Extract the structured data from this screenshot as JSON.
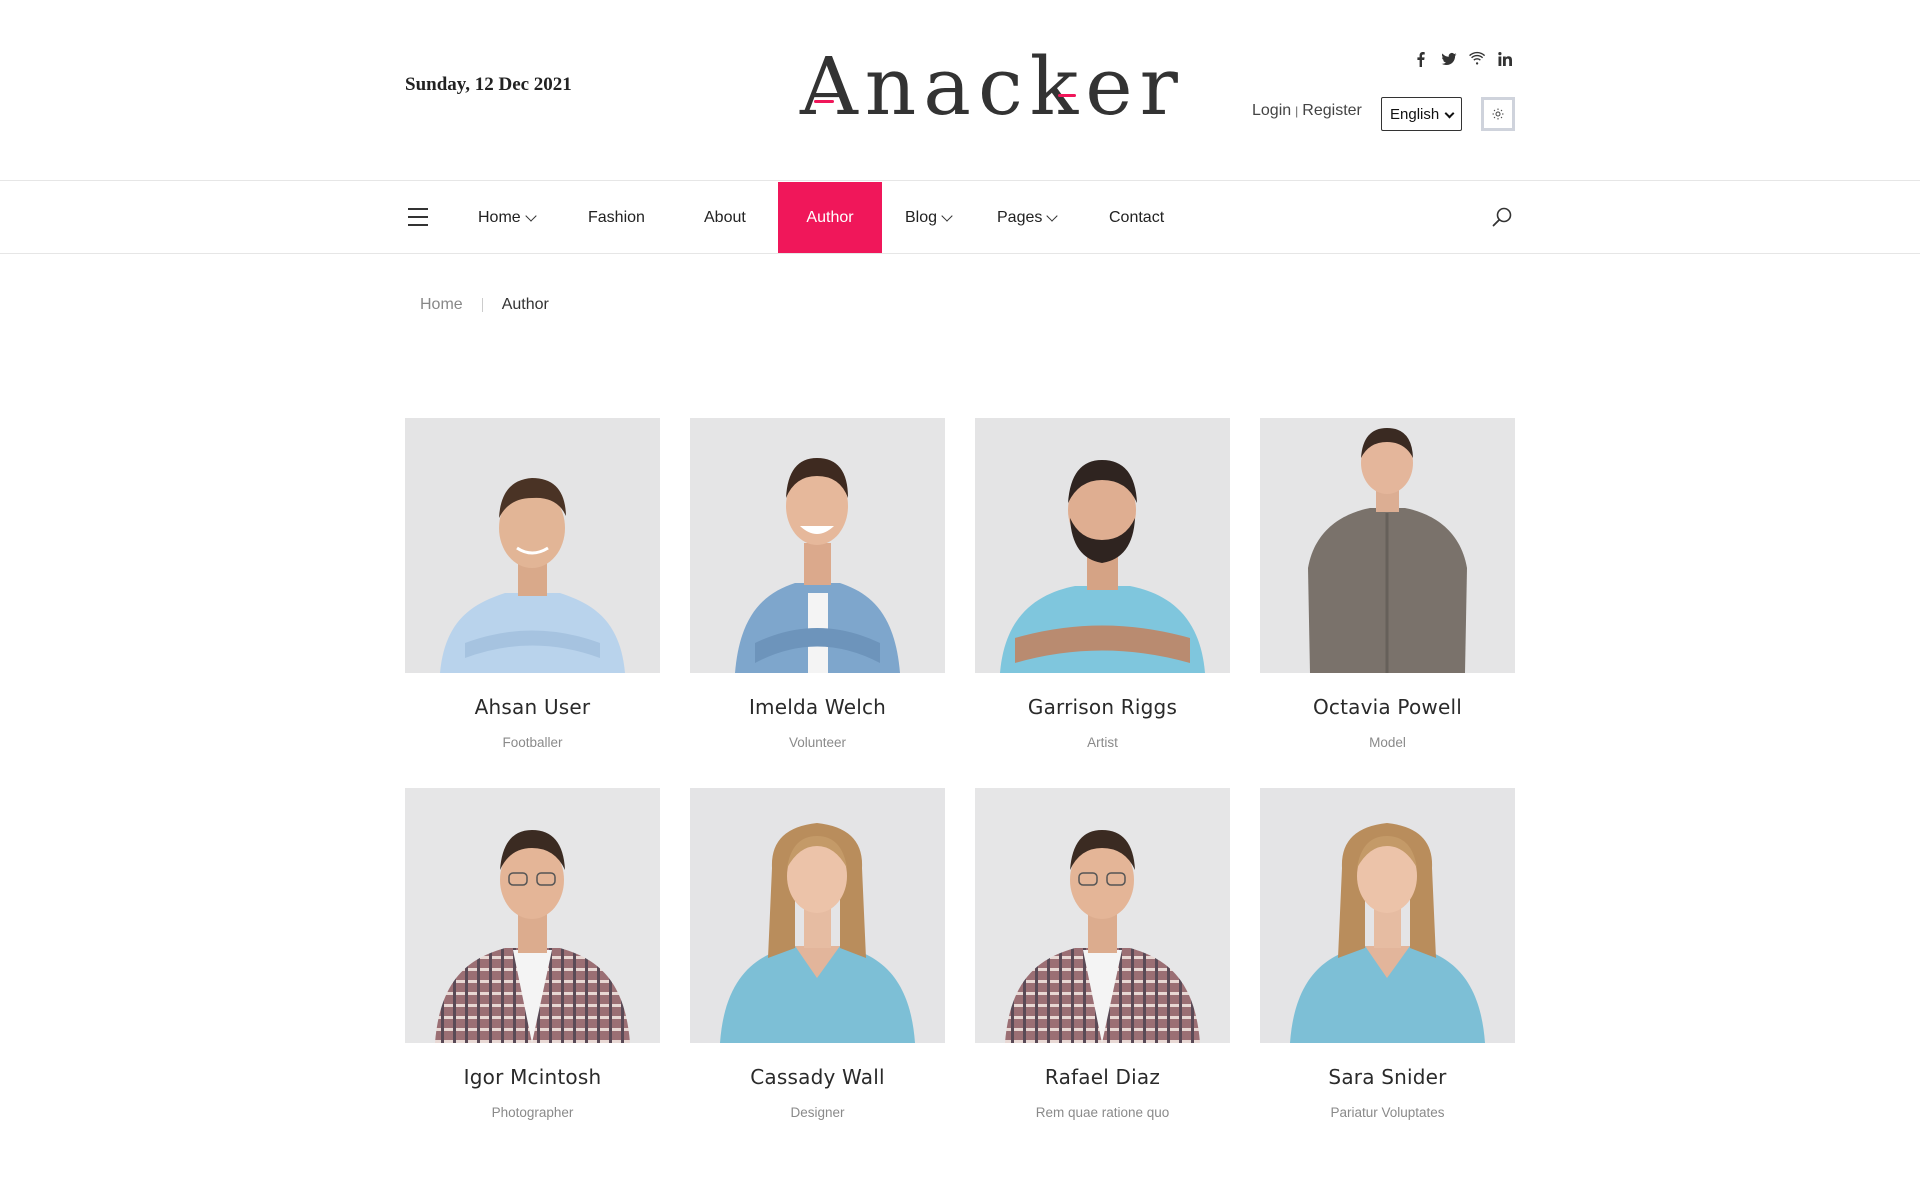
{
  "header": {
    "date": "Sunday, 12 Dec 2021",
    "logo_text": "Anacker",
    "socials": [
      "facebook-icon",
      "twitter-icon",
      "wifi-icon",
      "linkedin-icon"
    ],
    "login_label": "Login",
    "separator": "|",
    "register_label": "Register",
    "language": "English"
  },
  "nav": {
    "items": [
      {
        "label": "Home",
        "has_dropdown": true
      },
      {
        "label": "Fashion",
        "has_dropdown": false
      },
      {
        "label": "About",
        "has_dropdown": false
      },
      {
        "label": "Author",
        "has_dropdown": false,
        "active": true
      },
      {
        "label": "Blog",
        "has_dropdown": true
      },
      {
        "label": "Pages",
        "has_dropdown": true
      },
      {
        "label": "Contact",
        "has_dropdown": false
      }
    ]
  },
  "breadcrumb": {
    "home": "Home",
    "current": "Author"
  },
  "authors": [
    {
      "name": "Ahsan User",
      "role": "Footballer"
    },
    {
      "name": "Imelda Welch",
      "role": "Volunteer"
    },
    {
      "name": "Garrison Riggs",
      "role": "Artist"
    },
    {
      "name": "Octavia Powell",
      "role": "Model"
    },
    {
      "name": "Igor Mcintosh",
      "role": "Photographer"
    },
    {
      "name": "Cassady Wall",
      "role": "Designer"
    },
    {
      "name": "Rafael Diaz",
      "role": "Rem quae ratione quo"
    },
    {
      "name": "Sara Snider",
      "role": "Pariatur Voluptates"
    }
  ],
  "colors": {
    "accent": "#f0175a",
    "text": "#222222",
    "muted": "#8a8a8a",
    "photo_bg": "#e6e6e7"
  }
}
